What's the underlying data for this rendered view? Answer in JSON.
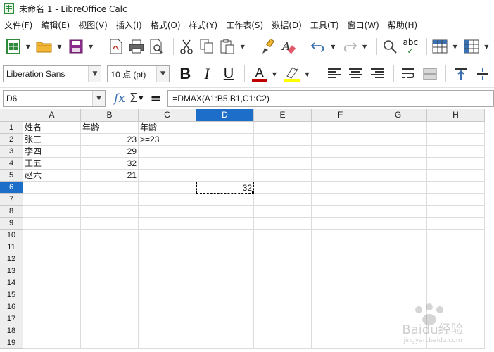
{
  "window": {
    "title": "未命名 1 - LibreOffice Calc"
  },
  "menu": [
    "文件(F)",
    "编辑(E)",
    "视图(V)",
    "插入(I)",
    "格式(O)",
    "样式(Y)",
    "工作表(S)",
    "数据(D)",
    "工具(T)",
    "窗口(W)",
    "帮助(H)"
  ],
  "toolbar": {
    "spellcheck_label": "abc"
  },
  "format": {
    "font_name": "Liberation Sans",
    "font_size": "10 点 (pt)",
    "bold_label": "B",
    "italic_label": "I",
    "underline_label": "U",
    "font_color_label": "A",
    "font_color": "#c00000",
    "highlight_color": "#ffff00"
  },
  "formula_bar": {
    "name_box": "D6",
    "fx_label": "fx",
    "sum_label": "Σ",
    "equals_label": "=",
    "formula": "=DMAX(A1:B5,B1,C1:C2)"
  },
  "sheet": {
    "columns": [
      "A",
      "B",
      "C",
      "D",
      "E",
      "F",
      "G",
      "H"
    ],
    "active_column": "D",
    "active_row": 6,
    "row_count": 19,
    "cells": {
      "A1": "姓名",
      "B1": "年龄",
      "C1": "年龄",
      "A2": "张三",
      "B2": "23",
      "C2": ">=23",
      "A3": "李四",
      "B3": "29",
      "A4": "王五",
      "B4": "32",
      "A5": "赵六",
      "B5": "21",
      "D6": "32"
    },
    "numeric_cells": [
      "B2",
      "B3",
      "B4",
      "B5",
      "D6"
    ]
  },
  "colors": {
    "accent": "#1d6ec9"
  },
  "watermark": {
    "text": "Baidu经验",
    "subtext": "jingyan.baidu.com"
  }
}
